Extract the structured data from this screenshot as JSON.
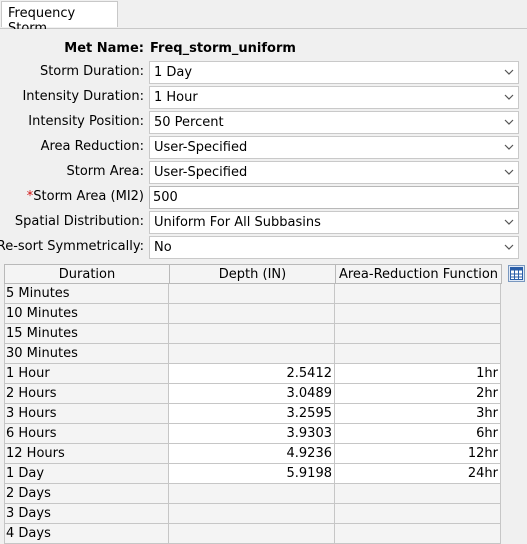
{
  "tab": {
    "label": "Frequency Storm"
  },
  "form": {
    "met_name_label": "Met Name:",
    "met_name_value": "Freq_storm_uniform",
    "storm_duration": {
      "label": "Storm Duration:",
      "value": "1 Day"
    },
    "intensity_duration": {
      "label": "Intensity Duration:",
      "value": "1 Hour"
    },
    "intensity_position": {
      "label": "Intensity Position:",
      "value": "50 Percent"
    },
    "area_reduction": {
      "label": "Area Reduction:",
      "value": "User-Specified"
    },
    "storm_area_select": {
      "label": "Storm Area:",
      "value": "User-Specified"
    },
    "storm_area_input": {
      "required_mark": "*",
      "label": "Storm Area (MI2)",
      "value": "500"
    },
    "spatial_distribution": {
      "label": "Spatial Distribution:",
      "value": "Uniform For All Subbasins"
    },
    "resort_symmetrically": {
      "label": "Re-sort Symmetrically:",
      "value": "No"
    }
  },
  "table": {
    "headers": [
      "Duration",
      "Depth (IN)",
      "Area-Reduction Function"
    ],
    "rows": [
      {
        "duration": "5 Minutes",
        "depth": "",
        "arf": ""
      },
      {
        "duration": "10 Minutes",
        "depth": "",
        "arf": ""
      },
      {
        "duration": "15 Minutes",
        "depth": "",
        "arf": ""
      },
      {
        "duration": "30 Minutes",
        "depth": "",
        "arf": ""
      },
      {
        "duration": "1 Hour",
        "depth": "2.5412",
        "arf": "1hr"
      },
      {
        "duration": "2 Hours",
        "depth": "3.0489",
        "arf": "2hr"
      },
      {
        "duration": "3 Hours",
        "depth": "3.2595",
        "arf": "3hr"
      },
      {
        "duration": "6 Hours",
        "depth": "3.9303",
        "arf": "6hr"
      },
      {
        "duration": "12 Hours",
        "depth": "4.9236",
        "arf": "12hr"
      },
      {
        "duration": "1 Day",
        "depth": "5.9198",
        "arf": "24hr"
      },
      {
        "duration": "2 Days",
        "depth": "",
        "arf": ""
      },
      {
        "duration": "3 Days",
        "depth": "",
        "arf": ""
      },
      {
        "duration": "4 Days",
        "depth": "",
        "arf": ""
      }
    ]
  },
  "icons": {
    "combo_arrow": "chevron-down-icon",
    "table_button": "table-grid-icon"
  },
  "colors": {
    "required": "#d01010",
    "header_bg": "#f4f4f4"
  }
}
